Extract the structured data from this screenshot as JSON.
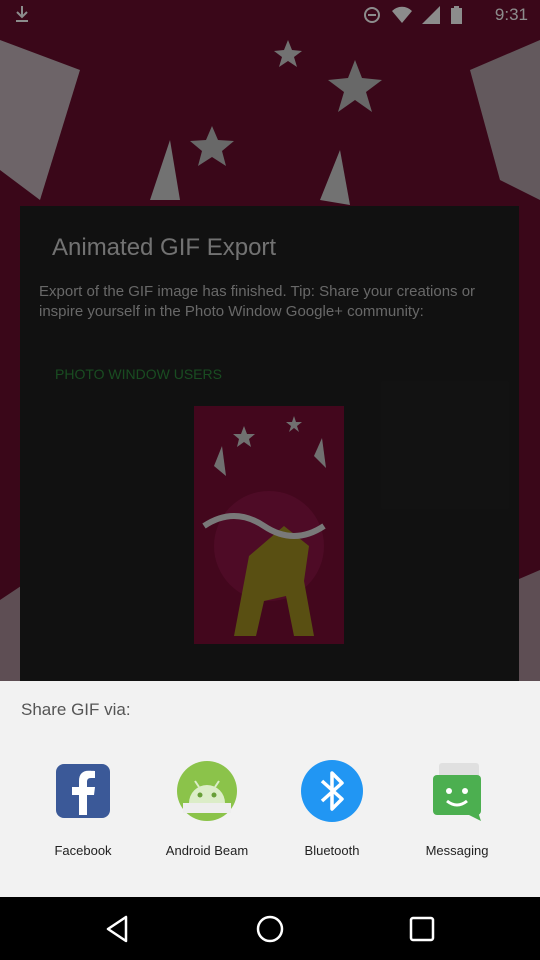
{
  "status_bar": {
    "time": "9:31"
  },
  "dialog": {
    "title": "Animated GIF Export",
    "message": "Export of the GIF image has finished. Tip: Share your creations or inspire yourself in the Photo Window Google+ community:",
    "link": "PHOTO WINDOW USERS"
  },
  "share_sheet": {
    "title": "Share GIF via:",
    "apps": [
      {
        "label": "Facebook",
        "icon": "facebook-icon",
        "color": "#3b5998"
      },
      {
        "label": "Android Beam",
        "icon": "android-beam-icon",
        "color": "#8bc34a"
      },
      {
        "label": "Bluetooth",
        "icon": "bluetooth-icon",
        "color": "#2196f3"
      },
      {
        "label": "Messaging",
        "icon": "messaging-icon",
        "color": "#4caf50"
      }
    ]
  }
}
